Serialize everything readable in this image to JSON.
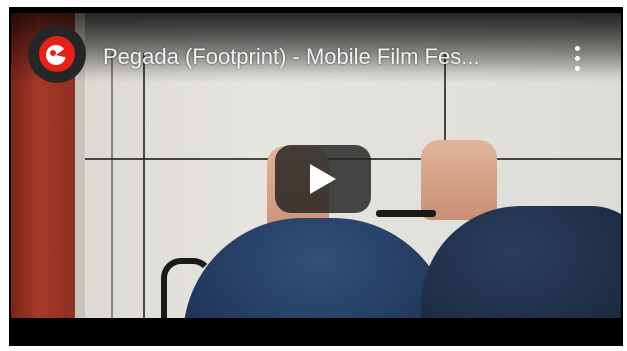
{
  "video": {
    "title": "Pegada (Footprint) - Mobile Film Fes...",
    "channel_avatar_icon": "red-circle-logo-icon",
    "menu_icon": "more-vertical-icon",
    "play_icon": "play-icon"
  },
  "colors": {
    "play_overlay": "#212121",
    "logo_red": "#e62117",
    "title_text": "#f2f2f2"
  }
}
